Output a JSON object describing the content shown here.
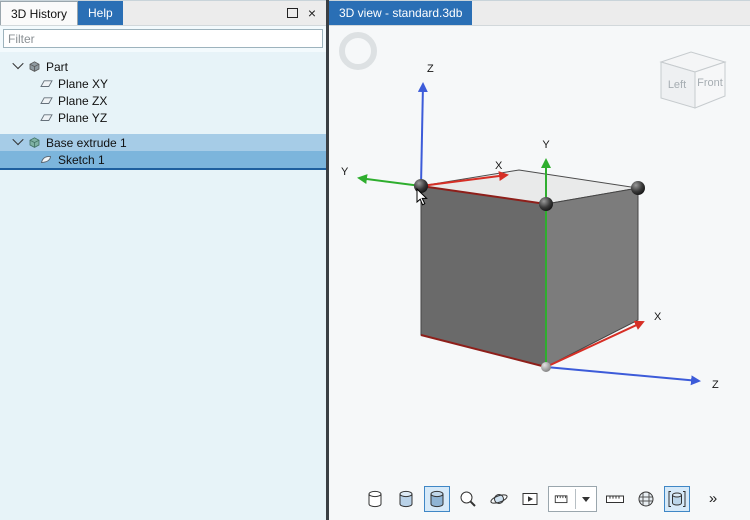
{
  "left_panel": {
    "tabs": {
      "history": "3D History",
      "help": "Help"
    },
    "window_buttons": {
      "close": "×"
    },
    "filter": {
      "placeholder": "Filter"
    },
    "tree": {
      "part": "Part",
      "plane_xy": "Plane XY",
      "plane_zx": "Plane ZX",
      "plane_yz": "Plane YZ",
      "base_extrude": "Base extrude 1",
      "sketch": "Sketch 1"
    }
  },
  "viewport": {
    "tab_title": "3D view - standard.3db",
    "view_cube": {
      "left": "Left",
      "front": "Front"
    },
    "axes_sketch": {
      "x": "X",
      "y": "Y",
      "z": "Z"
    },
    "axes_world": {
      "x": "X",
      "y": "Y",
      "z": "Z"
    },
    "toolbar": {
      "overflow": "»"
    }
  },
  "colors": {
    "accent_blue": "#2a6fb5",
    "axis_x": "#d62f26",
    "axis_y": "#2eae2e",
    "axis_z": "#3c5bd9",
    "selection_row": "#a6cce7",
    "selection_row_active": "#7cb5dc",
    "insert_line": "#1e5f9e"
  }
}
